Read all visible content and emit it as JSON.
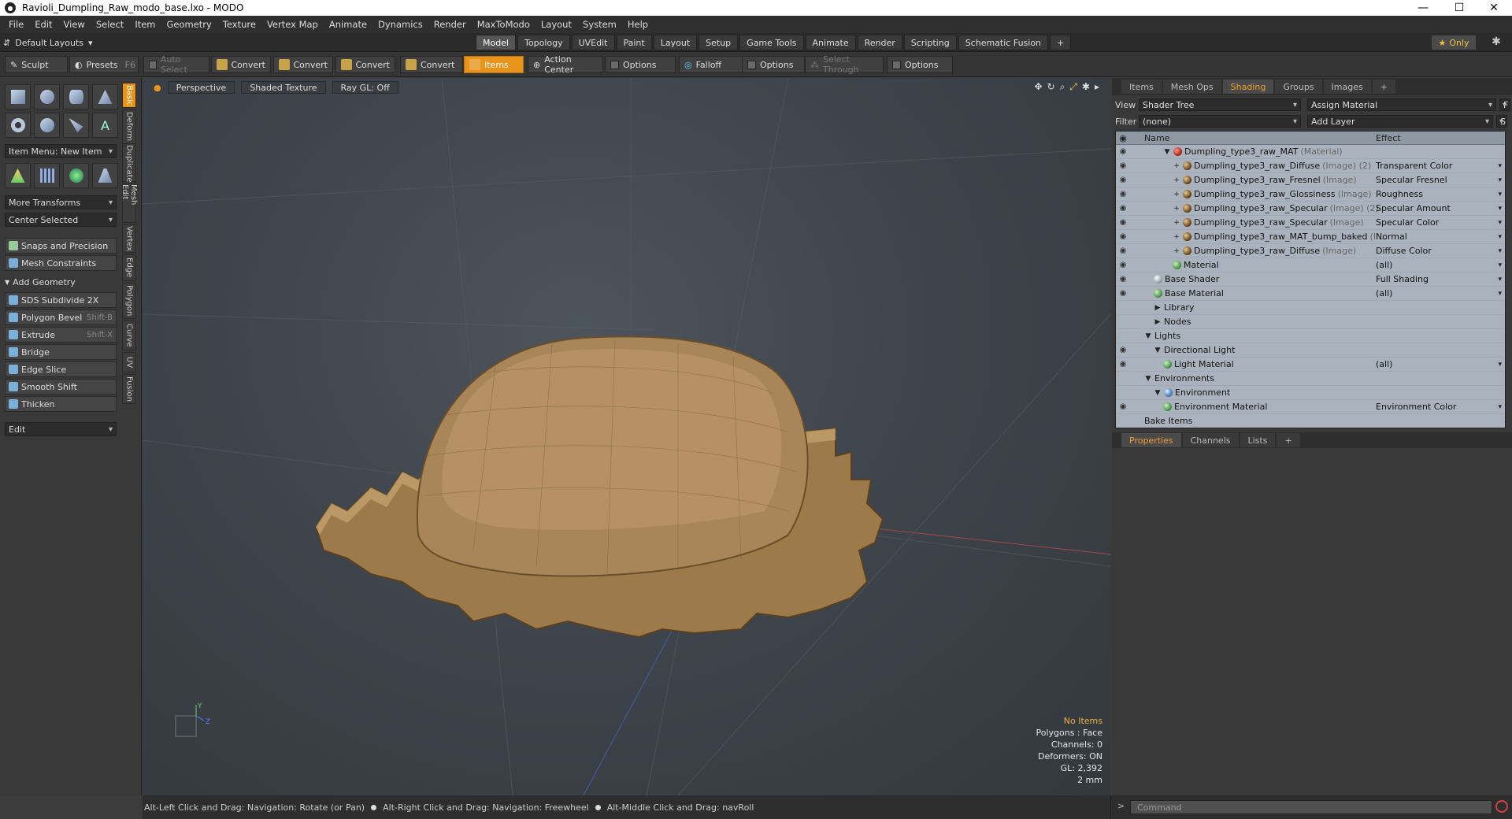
{
  "window": {
    "title": "Ravioli_Dumpling_Raw_modo_base.lxo - MODO",
    "app_icon": "modo-icon"
  },
  "menu": [
    "File",
    "Edit",
    "View",
    "Select",
    "Item",
    "Geometry",
    "Texture",
    "Vertex Map",
    "Animate",
    "Dynamics",
    "Render",
    "MaxToModo",
    "Layout",
    "System",
    "Help"
  ],
  "layout": {
    "default_layouts": "Default Layouts",
    "tabs": [
      "Model",
      "Topology",
      "UVEdit",
      "Paint",
      "Layout",
      "Setup",
      "Game Tools",
      "Animate",
      "Render",
      "Scripting",
      "Schematic Fusion",
      "+"
    ],
    "active_tab": "Model",
    "only": "Only"
  },
  "toolbar": {
    "sculpt": "Sculpt",
    "presets": "Presets",
    "presets_key": "F6",
    "auto_select": "Auto Select",
    "convert": "Convert",
    "items": "Items",
    "action_center": "Action Center",
    "options": "Options",
    "falloff": "Falloff",
    "select_through": "Select Through"
  },
  "left_panel": {
    "vertical_tabs": [
      "Basic",
      "Deform",
      "Duplicate",
      "Mesh Edit",
      "Vertex",
      "Edge",
      "Polygon",
      "Curve",
      "UV",
      "Fusion"
    ],
    "item_menu": "Item Menu: New Item",
    "more_transforms": "More Transforms",
    "center_selected": "Center Selected",
    "snaps": "Snaps and Precision",
    "mesh_constraints": "Mesh Constraints",
    "add_geometry": "Add Geometry",
    "tools": [
      {
        "label": "SDS Subdivide 2X",
        "key": ""
      },
      {
        "label": "Polygon Bevel",
        "key": "Shift-B"
      },
      {
        "label": "Extrude",
        "key": "Shift-X"
      },
      {
        "label": "Bridge",
        "key": ""
      },
      {
        "label": "Edge Slice",
        "key": ""
      },
      {
        "label": "Smooth Shift",
        "key": ""
      },
      {
        "label": "Thicken",
        "key": ""
      }
    ],
    "edit_dropdown": "Edit"
  },
  "viewport": {
    "perspective": "Perspective",
    "shading": "Shaded Texture",
    "raygl": "Ray GL: Off",
    "stats": {
      "items": "No Items",
      "polygons": "Polygons : Face",
      "channels": "Channels: 0",
      "deformers": "Deformers: ON",
      "gl": "GL: 2,392",
      "scale": "2 mm"
    }
  },
  "status": {
    "hint1": "Alt-Left Click and Drag: Navigation: Rotate (or Pan)",
    "hint2": "Alt-Right Click and Drag: Navigation: Freewheel",
    "hint3": "Alt-Middle Click and Drag: navRoll",
    "command_placeholder": "Command"
  },
  "right_panel": {
    "tabs": [
      "Items",
      "Mesh Ops",
      "Shading",
      "Groups",
      "Images",
      "+"
    ],
    "active_tab": "Shading",
    "view_label": "View",
    "view_value": "Shader Tree",
    "assign_material": "Assign Material",
    "filter_label": "Filter",
    "filter_value": "(none)",
    "add_layer": "Add Layer",
    "col_name": "Name",
    "col_effect": "Effect",
    "rows": [
      {
        "indent": 2,
        "toggle": "▼",
        "icon": "red",
        "name": "Dumpling_type3_raw_MAT",
        "suffix": "(Material)",
        "effect": "",
        "eye": true
      },
      {
        "indent": 3,
        "toggle": "+",
        "icon": "brown",
        "name": "Dumpling_type3_raw_Diffuse",
        "suffix": "(Image) (2)",
        "effect": "Transparent Color",
        "eye": true
      },
      {
        "indent": 3,
        "toggle": "+",
        "icon": "brown",
        "name": "Dumpling_type3_raw_Fresnel",
        "suffix": "(Image)",
        "effect": "Specular Fresnel",
        "eye": true
      },
      {
        "indent": 3,
        "toggle": "+",
        "icon": "brown",
        "name": "Dumpling_type3_raw_Glossiness",
        "suffix": "(Image)",
        "effect": "Roughness",
        "eye": true
      },
      {
        "indent": 3,
        "toggle": "+",
        "icon": "brown",
        "name": "Dumpling_type3_raw_Specular",
        "suffix": "(Image) (2)",
        "effect": "Specular Amount",
        "eye": true
      },
      {
        "indent": 3,
        "toggle": "+",
        "icon": "brown",
        "name": "Dumpling_type3_raw_Specular",
        "suffix": "(Image)",
        "effect": "Specular Color",
        "eye": true
      },
      {
        "indent": 3,
        "toggle": "+",
        "icon": "brown",
        "name": "Dumpling_type3_raw_MAT_bump_baked",
        "suffix": "(I ...",
        "effect": "Normal",
        "eye": true
      },
      {
        "indent": 3,
        "toggle": "+",
        "icon": "brown",
        "name": "Dumpling_type3_raw_Diffuse",
        "suffix": "(Image)",
        "effect": "Diffuse Color",
        "eye": true
      },
      {
        "indent": 3,
        "toggle": "",
        "icon": "green",
        "name": "Material",
        "suffix": "",
        "effect": "(all)",
        "eye": true
      },
      {
        "indent": 1,
        "toggle": "",
        "icon": "grey",
        "name": "Base Shader",
        "suffix": "",
        "effect": "Full Shading",
        "eye": true
      },
      {
        "indent": 1,
        "toggle": "",
        "icon": "green",
        "name": "Base Material",
        "suffix": "",
        "effect": "(all)",
        "eye": true
      },
      {
        "indent": 1,
        "toggle": "▶",
        "icon": "",
        "name": "Library",
        "suffix": "",
        "effect": "",
        "eye": false
      },
      {
        "indent": 1,
        "toggle": "▶",
        "icon": "",
        "name": "Nodes",
        "suffix": "",
        "effect": "",
        "eye": false
      },
      {
        "indent": 0,
        "toggle": "▼",
        "icon": "",
        "name": "Lights",
        "suffix": "",
        "effect": "",
        "eye": false
      },
      {
        "indent": 1,
        "toggle": "▼",
        "icon": "",
        "name": "Directional Light",
        "suffix": "",
        "effect": "",
        "eye": true
      },
      {
        "indent": 2,
        "toggle": "",
        "icon": "green",
        "name": "Light Material",
        "suffix": "",
        "effect": "(all)",
        "eye": true
      },
      {
        "indent": 0,
        "toggle": "▼",
        "icon": "",
        "name": "Environments",
        "suffix": "",
        "effect": "",
        "eye": false
      },
      {
        "indent": 1,
        "toggle": "▼",
        "icon": "blue",
        "name": "Environment",
        "suffix": "",
        "effect": "",
        "eye": false
      },
      {
        "indent": 2,
        "toggle": "",
        "icon": "green",
        "name": "Environment Material",
        "suffix": "",
        "effect": "Environment Color",
        "eye": true
      },
      {
        "indent": 0,
        "toggle": "",
        "icon": "",
        "name": "Bake Items",
        "suffix": "",
        "effect": "",
        "eye": false
      }
    ],
    "prop_tabs": [
      "Properties",
      "Channels",
      "Lists",
      "+"
    ],
    "active_prop_tab": "Properties"
  },
  "colors": {
    "accent": "#e8941a",
    "tree_bg": "#aab3bd"
  }
}
